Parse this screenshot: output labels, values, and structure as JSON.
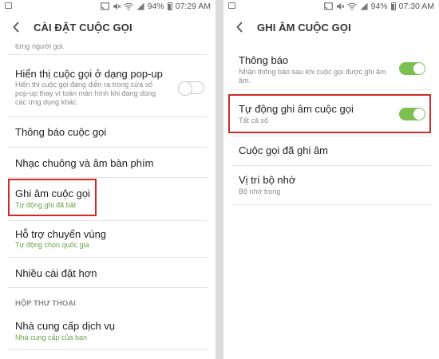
{
  "left": {
    "status": {
      "battery": "94%",
      "time": "07:29 AM"
    },
    "title": "CÀI ĐẶT CUỘC GỌI",
    "top_partial": "từng người gọi.",
    "popup": {
      "title": "Hiển thị cuộc gọi ở dạng pop-up",
      "sub1": "Hiển thị cuộc gọi đang diễn ra trong cửa sổ",
      "sub2": "pop-up thay vì toàn màn hình khi đang dùng",
      "sub3": "các ứng dụng khác."
    },
    "notify": "Thông báo cuộc gọi",
    "ringtone": "Nhạc chuông và âm bàn phím",
    "record": {
      "title": "Ghi âm cuộc gọi",
      "sub": "Tự động ghi đã bật"
    },
    "roaming": {
      "title": "Hỗ trợ chuyển vùng",
      "sub": "Tự động chọn quốc gia"
    },
    "more": "Nhiều cài đặt hơn",
    "section": "HỘP THƯ THOẠI",
    "provider": {
      "title": "Nhà cung cấp dịch vụ",
      "sub": "Nhà cung cấp của bạn"
    }
  },
  "right": {
    "status": {
      "battery": "94%",
      "time": "07:30 AM"
    },
    "title": "GHI ÂM CUỘC GỌI",
    "notify": {
      "title": "Thông báo",
      "sub1": "Nhận thông báo sau khi cuộc gọi được ghi âm",
      "sub2": "âm."
    },
    "auto": {
      "title": "Tự động ghi âm cuộc gọi",
      "sub": "Tất cả số"
    },
    "recorded": "Cuộc gọi đã ghi âm",
    "storage": {
      "title": "Vị trí bộ nhớ",
      "sub": "Bộ nhớ trong"
    }
  }
}
